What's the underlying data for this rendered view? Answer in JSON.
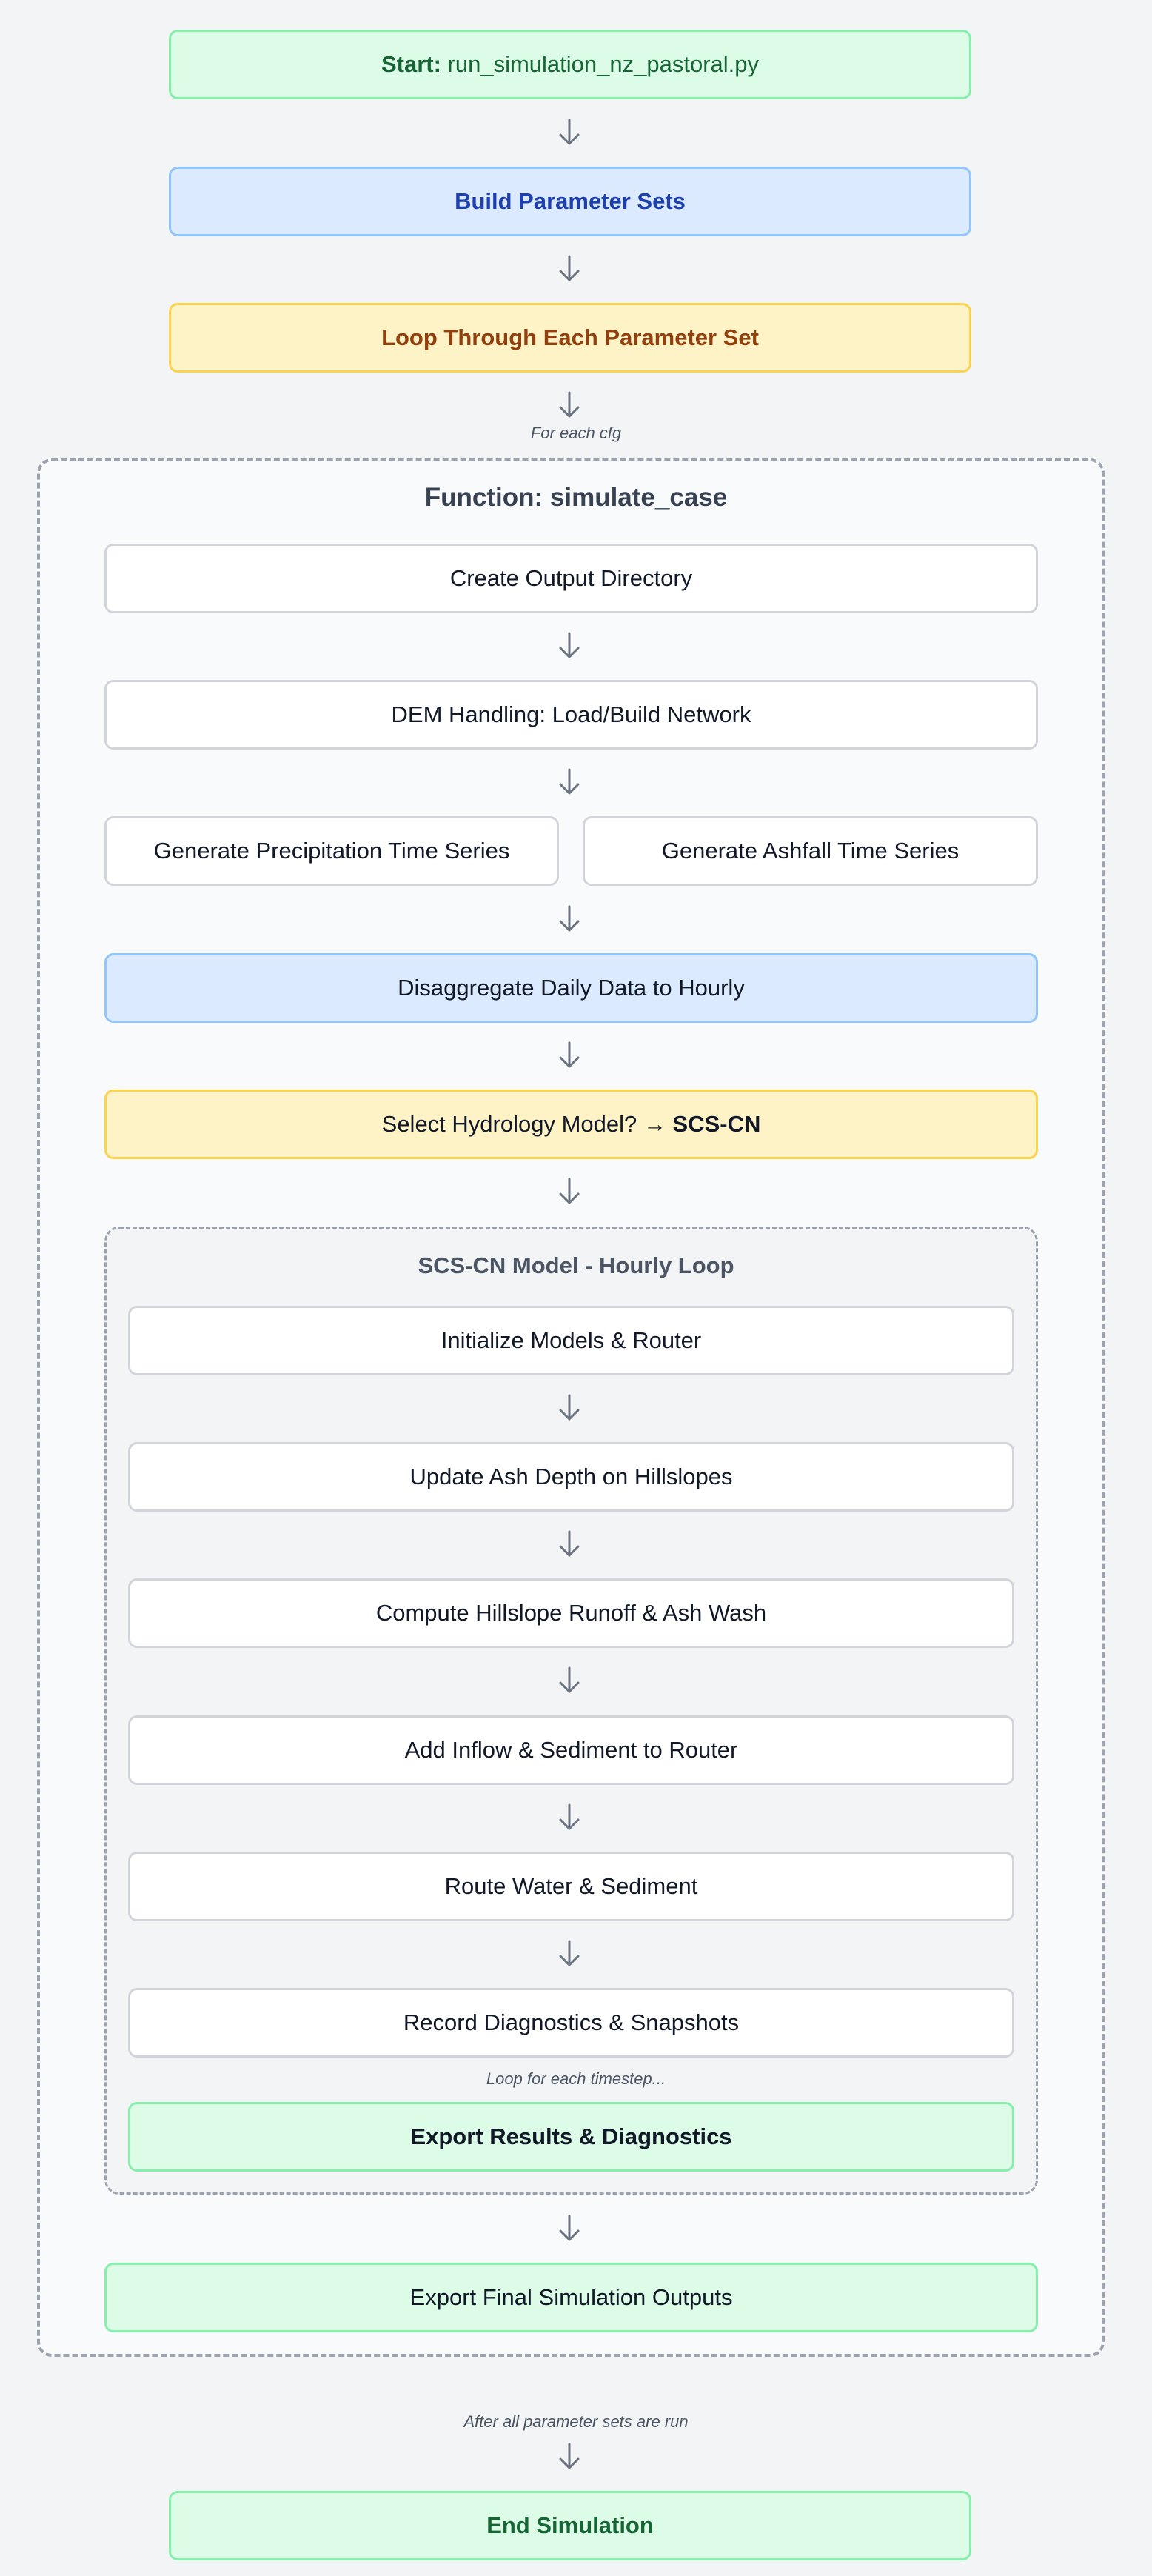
{
  "start": {
    "prefix": "Start:",
    "script": "run_simulation_nz_pastoral.py"
  },
  "build": "Build Parameter Sets",
  "loop": "Loop Through Each Parameter Set",
  "for_each": "For each cfg",
  "function_title": "Function: simulate_case",
  "steps": {
    "output_dir": "Create Output Directory",
    "dem": "DEM Handling: Load/Build Network",
    "precip": "Generate Precipitation Time Series",
    "ashfall": "Generate Ashfall Time Series",
    "disaggregate": "Disaggregate Daily Data to Hourly",
    "select_model_prefix": "Select Hydrology Model? →",
    "select_model_value": "SCS-CN"
  },
  "scs": {
    "title": "SCS-CN Model - Hourly Loop",
    "steps": [
      "Initialize Models & Router",
      "Update Ash Depth on Hillslopes",
      "Compute Hillslope Runoff & Ash Wash",
      "Add Inflow & Sediment to Router",
      "Route Water & Sediment",
      "Record Diagnostics & Snapshots"
    ],
    "loop_note": "Loop for each timestep...",
    "export": "Export Results & Diagnostics"
  },
  "export_final": "Export Final Simulation Outputs",
  "after_note": "After all parameter sets are run",
  "end": "End Simulation"
}
